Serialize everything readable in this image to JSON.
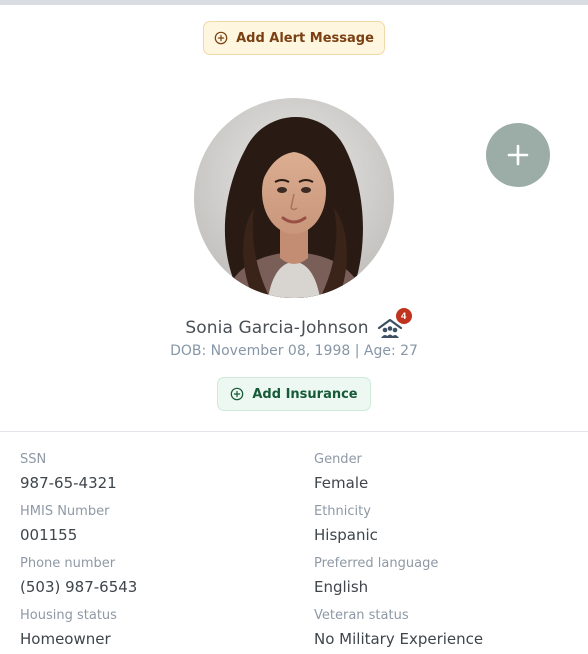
{
  "alert_button": {
    "label": "Add Alert Message",
    "icon": "plus-circle-icon"
  },
  "fab": {
    "icon": "plus-icon"
  },
  "profile": {
    "name": "Sonia Garcia-Johnson",
    "household_icon": "household-icon",
    "household_count": "4",
    "dob_line": "DOB: November 08, 1998 | Age: 27"
  },
  "insurance_button": {
    "label": "Add Insurance",
    "icon": "plus-circle-icon"
  },
  "details": {
    "ssn": {
      "label": "SSN",
      "value": "987-65-4321"
    },
    "hmis": {
      "label": "HMIS Number",
      "value": "001155"
    },
    "phone": {
      "label": "Phone number",
      "value": "(503) 987-6543"
    },
    "housing": {
      "label": "Housing status",
      "value": "Homeowner"
    },
    "gender": {
      "label": "Gender",
      "value": "Female"
    },
    "ethnicity": {
      "label": "Ethnicity",
      "value": "Hispanic"
    },
    "language": {
      "label": "Preferred language",
      "value": "English"
    },
    "veteran": {
      "label": "Veteran status",
      "value": "No Military Experience"
    }
  },
  "colors": {
    "alert_text": "#7a4012",
    "alert_bg": "#fff6e0",
    "insurance_text": "#175a37",
    "insurance_bg": "#ecf8f1",
    "fab_bg": "#9bada6",
    "badge_bg": "#c0331e"
  }
}
